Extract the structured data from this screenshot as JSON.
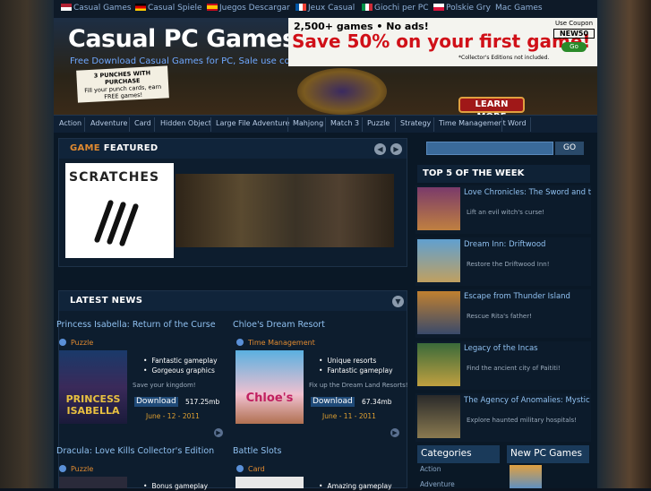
{
  "languages": [
    {
      "label": "Casual Games",
      "flag": "us"
    },
    {
      "label": "Casual Spiele",
      "flag": "de"
    },
    {
      "label": "Juegos Descargar",
      "flag": "es"
    },
    {
      "label": "Jeux Casual",
      "flag": "fr"
    },
    {
      "label": "Giochi per PC",
      "flag": "it"
    },
    {
      "label": "Polskie Gry",
      "flag": "pl"
    },
    {
      "label": "Mac Games",
      "flag": "none"
    }
  ],
  "header": {
    "site_title": "Casual PC Games",
    "tagline": "Free Download Casual Games for PC, Sale use coupon",
    "promo_games": "2,500+ games • No ads!",
    "promo_save": "Save 50% on your first game!",
    "promo_note": "*Collector's Editions not included.",
    "coupon_label": "Use Coupon",
    "coupon_code": "NEW50",
    "coupon_go": "Go",
    "punch_line1": "3 PUNCHES WITH PURCHASE",
    "punch_line2": "Fill your punch cards, earn FREE games!",
    "learn_more": "LEARN MORE"
  },
  "nav": [
    "Action",
    "Adventure",
    "Card",
    "Hidden Object",
    "Large File Adventure",
    "Mahjong",
    "Match 3",
    "Puzzle",
    "Strategy",
    "Time Management",
    "Word"
  ],
  "featured": {
    "title_prefix": "GAME",
    "title": "FEATURED",
    "image_text": "SCRATCHES"
  },
  "latest_news": {
    "title": "LATEST NEWS",
    "items": [
      {
        "title": "Princess Isabella: Return of the Curse",
        "category": "Puzzle",
        "bullets": [
          "Fantastic gameplay",
          "Gorgeous graphics"
        ],
        "desc": "Save your kingdom!",
        "download": "Download",
        "size": "517.25mb",
        "date": "June - 12 - 2011"
      },
      {
        "title": "Chloe's Dream Resort",
        "category": "Time Management",
        "bullets": [
          "Unique resorts",
          "Fantastic gameplay"
        ],
        "desc": "Fix up the Dream Land Resorts!",
        "download": "Download",
        "size": "67.34mb",
        "date": "June - 11 - 2011"
      },
      {
        "title": "Dracula: Love Kills Collector's Edition",
        "category": "Puzzle",
        "bullets": [
          "Bonus gameplay"
        ]
      },
      {
        "title": "Battle Slots",
        "category": "Card",
        "bullets": [
          "Amazing gameplay"
        ]
      }
    ]
  },
  "search": {
    "button": "GO",
    "placeholder": ""
  },
  "top5": {
    "title": "TOP 5 OF THE WEEK",
    "items": [
      {
        "title": "Love Chronicles: The Sword and the Rose Collector's Edition",
        "desc": "Lift an evil witch's curse!"
      },
      {
        "title": "Dream Inn: Driftwood",
        "desc": "Restore the Driftwood Inn!"
      },
      {
        "title": "Escape from Thunder Island",
        "desc": "Rescue Rita's father!"
      },
      {
        "title": "Legacy of the Incas",
        "desc": "Find the ancient city of Paititi!"
      },
      {
        "title": "The Agency of Anomalies: Mystic Hospital",
        "desc": "Explore haunted military hospitals!"
      }
    ]
  },
  "categories": {
    "title": "Categories",
    "items": [
      "Action",
      "Adventure"
    ]
  },
  "new_games": {
    "title": "New PC Games"
  },
  "colors": {
    "accent": "#8fc0f0",
    "category": "#e08a30",
    "date": "#e0a030",
    "promo_red": "#d01018"
  }
}
